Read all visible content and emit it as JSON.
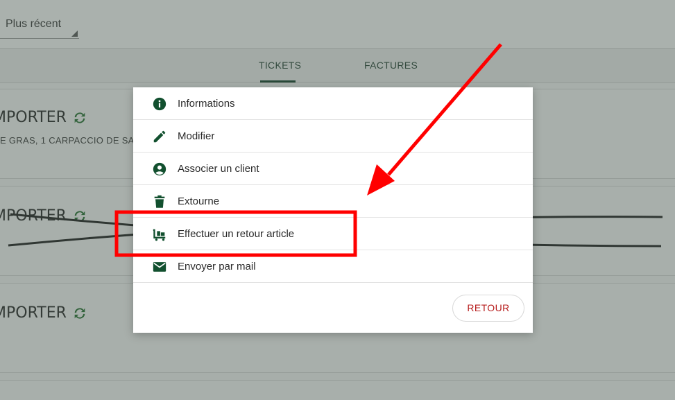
{
  "header": {
    "sort_value": "Plus récent"
  },
  "tabs": [
    {
      "label": "TICKETS",
      "active": true
    },
    {
      "label": "FACTURES",
      "active": false
    }
  ],
  "tickets": [
    {
      "title": "MPORTER",
      "items": "E GRAS, 1 CARPACCIO DE SAU"
    },
    {
      "title": "MPORTER",
      "items": ""
    },
    {
      "title": "MPORTER",
      "items": ""
    }
  ],
  "dialog": {
    "items": [
      {
        "label": "Informations",
        "icon": "info-icon"
      },
      {
        "label": "Modifier",
        "icon": "pencil-icon"
      },
      {
        "label": "Associer un client",
        "icon": "user-circle-icon"
      },
      {
        "label": "Extourne",
        "icon": "trash-icon"
      },
      {
        "label": "Effectuer un retour article",
        "icon": "dolly-icon"
      },
      {
        "label": "Envoyer par mail",
        "icon": "envelope-icon"
      }
    ],
    "back_button": "RETOUR"
  },
  "colors": {
    "primary_dark_green": "#0d3b26",
    "icon_green": "#12502f",
    "refresh_green": "#1f6b2a",
    "back_text_red": "#b71c1c",
    "annotation_red": "#ff0000"
  }
}
